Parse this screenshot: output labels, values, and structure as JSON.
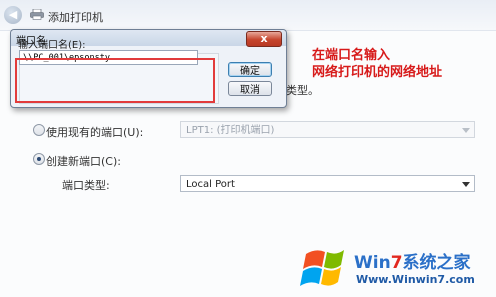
{
  "wizard": {
    "title": "添加打印机",
    "back_icon": "back-arrow-icon",
    "printer_icon": "printer-icon",
    "behind_text": "类型。",
    "use_existing_port_label": "使用现有的端口(U):",
    "existing_port_value": "LPT1: (打印机端口)",
    "create_new_port_label": "创建新端口(C):",
    "port_type_label": "端口类型:",
    "port_type_value": "Local Port",
    "selected_option": "create_new_port"
  },
  "dialog": {
    "title": "端口名",
    "field_label": "输入端口名(E):",
    "field_value": "\\\\PC_001\\epsonsty",
    "ok_label": "确定",
    "cancel_label": "取消",
    "close_icon": "close-icon",
    "close_glyph": "x"
  },
  "annotation": {
    "line1": "在端口名输入",
    "line2": "网络打印机的网络地址",
    "color": "#d71a1a"
  },
  "watermark": {
    "brand_prefix": "Win",
    "brand_seven": "7",
    "brand_suffix": "系统之家",
    "url": "Www.Winwin7.com"
  }
}
